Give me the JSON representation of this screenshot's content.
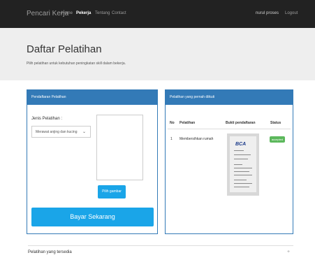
{
  "navbar": {
    "brand": "Pencari Kerja",
    "links": [
      "Home",
      "Pekerja",
      "Tentang",
      "Contact"
    ],
    "active_link": "Pekerja",
    "user_name": "nurul proses",
    "logout_label": "Logout"
  },
  "header": {
    "title": "Daftar Pelatihan",
    "subtitle": "Pilih pelatihan untuk kebutuhan peningkatan skill dalam bekerja."
  },
  "registration_panel": {
    "heading": "Pendaftaran Pelatihan",
    "field_label": "Jenis Pelatihan :",
    "selected_option": "Merawat anjing dan kucing",
    "pick_image_label": "Pilih gambar",
    "pay_button_label": "Bayar Sekarang"
  },
  "history_panel": {
    "heading": "Pelatihan yang pernah diikuti",
    "columns": [
      "No",
      "Pelatihan",
      "Bukti pendaftaran",
      "Status"
    ],
    "rows": [
      {
        "no": "1",
        "pelatihan": "Membersihkan rumah",
        "proof_logo": "BCA",
        "status": "accepted"
      }
    ]
  },
  "available_section": {
    "title": "Pelatihan yang tersedia",
    "toggle_symbol": "+"
  },
  "colors": {
    "navbar": "#222222",
    "panel": "#337ab7",
    "button": "#1aa5e8",
    "status": "#5cb85c"
  }
}
